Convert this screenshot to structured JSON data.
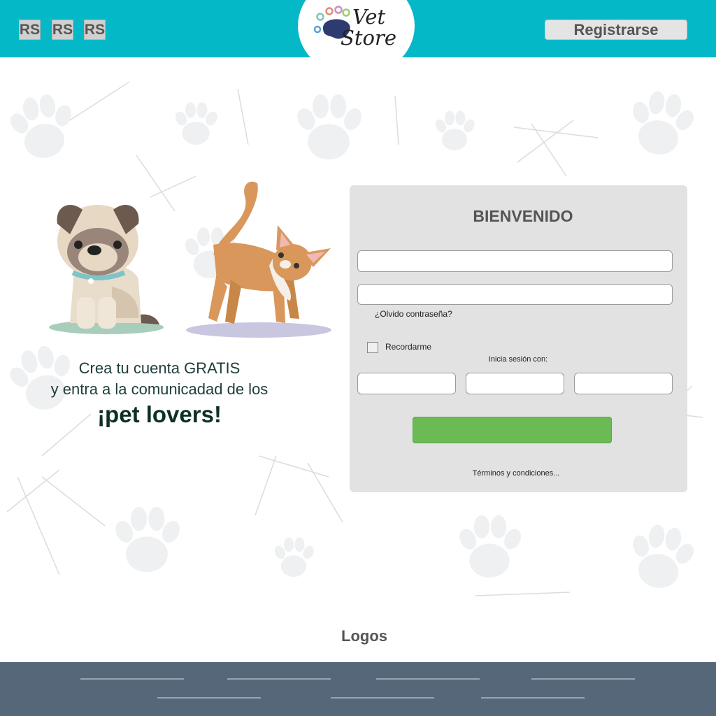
{
  "header": {
    "social_icons": [
      "RS",
      "RS",
      "RS"
    ],
    "brand_line1": "Vet",
    "brand_line2": "Store",
    "register_label": "Registrarse"
  },
  "promo": {
    "line1": "Crea tu cuenta GRATIS",
    "line2": "y entra a la comunicadad de los",
    "line3": "¡pet lovers!"
  },
  "login": {
    "title": "BIENVENIDO",
    "username_value": "",
    "password_value": "",
    "forgot_label": "¿Olvido contraseña?",
    "remember_label": "Recordarme",
    "social_login_label": "Inicia sesión con:",
    "submit_label": "",
    "terms_label": "Términos y condiciones..."
  },
  "footer": {
    "logos_label": "Logos"
  },
  "colors": {
    "header_bg": "#04b8c7",
    "login_button": "#6abb54",
    "card_bg": "#e2e2e2",
    "footer_bg": "#56677a",
    "promo_text": "#1e3d3a"
  },
  "icons": [
    "paw-print-icon",
    "pug-illustration",
    "cat-illustration",
    "vet-store-logo"
  ]
}
